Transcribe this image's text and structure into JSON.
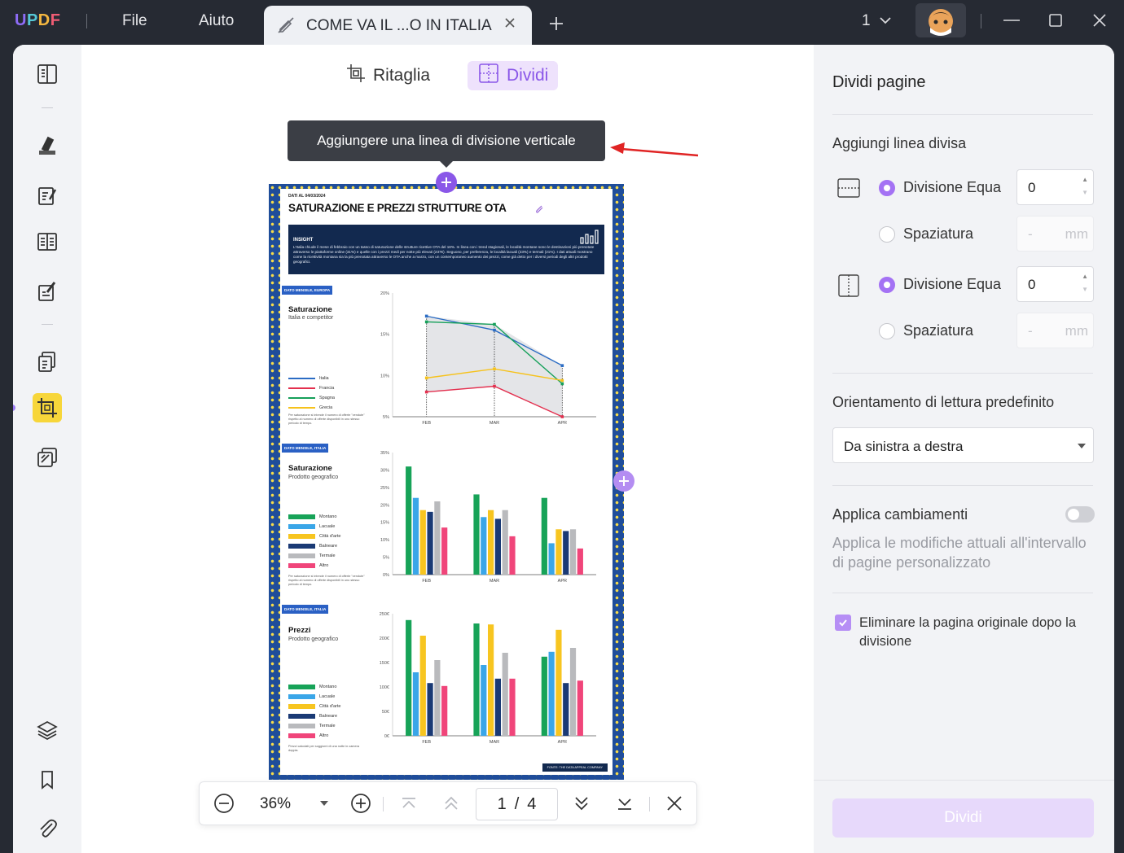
{
  "app": {
    "logo": "UPDF",
    "menu": [
      "File",
      "Aiuto"
    ],
    "tab_title": "COME VA IL ...O IN ITALIA",
    "page_indicator": "1"
  },
  "modes": {
    "crop": "Ritaglia",
    "split": "Dividi"
  },
  "tooltip": "Aggiungere una linea di divisione verticale",
  "document": {
    "date": "DATI AL 04/03/2024",
    "title": "SATURAZIONE E PREZZI STRUTTURE OTA",
    "insight_heading": "INSIGHT",
    "insight_text": "L'Italia chiude il mese di febbraio con un tasso di saturazione delle strutture ricettive OTA del 18%. In linea con i trend stagionali, le località montane sono le destinazioni più prenotate attraverso le piattaforme online (31%) e quelle con i prezzi medi per notte più elevati (237€). Seguono, per preferenza, le località lacuali (23%) e termali (21%). I dati attuali mostrano come la ricettività montana sia la più prenotata attraverso le OTA anche a marzo, con un contemporaneo aumento dei prezzi, come già detto per i diversi periodi degli altri prodotti geografici.",
    "source": "FONTE: THE DATA APPEAL COMPANY",
    "sections": [
      {
        "tag": "DATO MENSILE, EUROPA",
        "title": "Saturazione",
        "subtitle": "Italia e competitor",
        "legend": [
          "Italia",
          "Francia",
          "Spagna",
          "Grecia"
        ],
        "note": "Per saturazione si intende il numero di offerte \"vendute\" rispetto al numero di offerte disponibili in uno stesso periodo di tempo."
      },
      {
        "tag": "DATO MENSILE, ITALIA",
        "title": "Saturazione",
        "subtitle": "Prodotto geografico",
        "legend": [
          "Montano",
          "Lacuale",
          "Città d'arte",
          "Balneare",
          "Termale",
          "Altro"
        ],
        "note": "Per saturazione si intende il numero di offerte \"vendute\" rispetto al numero di offerte disponibili in uno stesso periodo di tempo."
      },
      {
        "tag": "DATO MENSILE, ITALIA",
        "title": "Prezzi",
        "subtitle": "Prodotto geografico",
        "legend": [
          "Montano",
          "Lacuale",
          "Città d'arte",
          "Balneare",
          "Termale",
          "Altro"
        ],
        "note": "Prezzi calcolati per soggiorni di una notte in camera doppia."
      }
    ]
  },
  "chart_data": [
    {
      "type": "line",
      "categories": [
        "FEB",
        "MAR",
        "APR"
      ],
      "y_ticks": [
        "20%",
        "15%",
        "10%",
        "5%"
      ],
      "ylim": [
        5,
        20
      ],
      "series": [
        {
          "name": "Italia",
          "color": "#2b6cc4",
          "values": [
            17.2,
            15.5,
            11.2
          ]
        },
        {
          "name": "Francia",
          "color": "#e3304f",
          "values": [
            8.0,
            8.7,
            5.0
          ]
        },
        {
          "name": "Spagna",
          "color": "#16a05a",
          "values": [
            16.5,
            16.2,
            9.0
          ]
        },
        {
          "name": "Grecia",
          "color": "#f6c21c",
          "values": [
            9.7,
            10.8,
            9.4
          ]
        }
      ]
    },
    {
      "type": "bar",
      "categories": [
        "FEB",
        "MAR",
        "APR"
      ],
      "y_ticks": [
        "35%",
        "30%",
        "25%",
        "20%",
        "15%",
        "10%",
        "5%",
        "0%"
      ],
      "ylim": [
        0,
        35
      ],
      "series": [
        {
          "name": "Montano",
          "color": "#17a358",
          "values": [
            31,
            23,
            22
          ]
        },
        {
          "name": "Lacuale",
          "color": "#3aa6e8",
          "values": [
            22,
            16.5,
            9
          ]
        },
        {
          "name": "Città d'arte",
          "color": "#f7c520",
          "values": [
            18.5,
            18.5,
            13
          ]
        },
        {
          "name": "Balneare",
          "color": "#1a3a75",
          "values": [
            18,
            16,
            12.5
          ]
        },
        {
          "name": "Termale",
          "color": "#b9babd",
          "values": [
            21,
            18.5,
            13
          ]
        },
        {
          "name": "Altro",
          "color": "#f0457a",
          "values": [
            13.5,
            11,
            7.5
          ]
        }
      ]
    },
    {
      "type": "bar",
      "categories": [
        "FEB",
        "MAR",
        "APR"
      ],
      "y_ticks": [
        "250€",
        "200€",
        "150€",
        "100€",
        "50€",
        "0€"
      ],
      "ylim": [
        0,
        250
      ],
      "series": [
        {
          "name": "Montano",
          "color": "#17a358",
          "values": [
            237,
            230,
            162
          ]
        },
        {
          "name": "Lacuale",
          "color": "#3aa6e8",
          "values": [
            130,
            145,
            172
          ]
        },
        {
          "name": "Città d'arte",
          "color": "#f7c520",
          "values": [
            205,
            228,
            217
          ]
        },
        {
          "name": "Balneare",
          "color": "#1a3a75",
          "values": [
            108,
            117,
            108
          ]
        },
        {
          "name": "Termale",
          "color": "#b9babd",
          "values": [
            155,
            170,
            180
          ]
        },
        {
          "name": "Altro",
          "color": "#f0457a",
          "values": [
            102,
            117,
            113
          ]
        }
      ]
    }
  ],
  "bottombar": {
    "zoom": "36%",
    "current_page": "1",
    "page_sep": "/",
    "total_pages": "4"
  },
  "panel": {
    "title": "Dividi pagine",
    "add_line": "Aggiungi linea divisa",
    "equal_division": "Divisione Equa",
    "spacing": "Spaziatura",
    "h_equal_value": "0",
    "v_equal_value": "0",
    "spacing_placeholder": "-",
    "unit": "mm",
    "orientation_label": "Orientamento di lettura predefinito",
    "orientation_value": "Da sinistra a destra",
    "apply_label": "Applica cambiamenti",
    "apply_desc": "Applica le modifiche attuali all'intervallo di pagine personalizzato",
    "delete_original": "Eliminare la pagina originale dopo la divisione",
    "split_button": "Dividi"
  }
}
